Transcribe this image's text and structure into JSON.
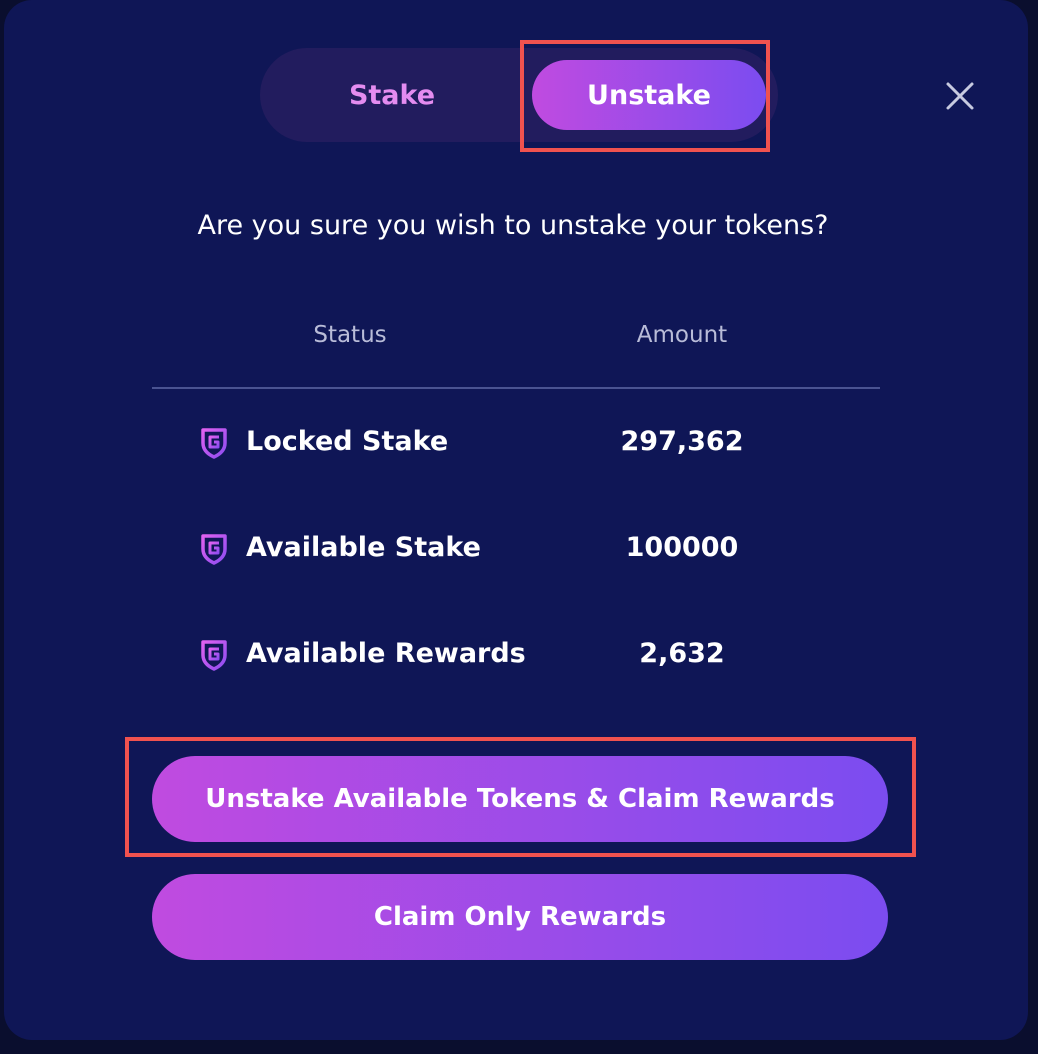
{
  "tabs": {
    "stake_label": "Stake",
    "unstake_label": "Unstake",
    "active": "Unstake"
  },
  "dialog": {
    "question": "Are you sure you wish to unstake your tokens?"
  },
  "table": {
    "headers": [
      "Status",
      "Amount"
    ],
    "rows": [
      {
        "label": "Locked Stake",
        "value": "297,362",
        "icon": "g-shield-icon"
      },
      {
        "label": "Available Stake",
        "value": "100000",
        "icon": "g-shield-icon"
      },
      {
        "label": "Available Rewards",
        "value": "2,632",
        "icon": "g-shield-icon"
      }
    ]
  },
  "buttons": {
    "unstake_claim_label": "Unstake Available Tokens & Claim Rewards",
    "claim_only_label": "Claim Only Rewards"
  },
  "icons": {
    "close": "close-icon"
  },
  "colors": {
    "modal_bg": "#0f1656",
    "accent_start": "#c04be0",
    "accent_end": "#7b4cf0",
    "stake_tab_text": "#e48cf0",
    "highlight": "#f0524f"
  }
}
